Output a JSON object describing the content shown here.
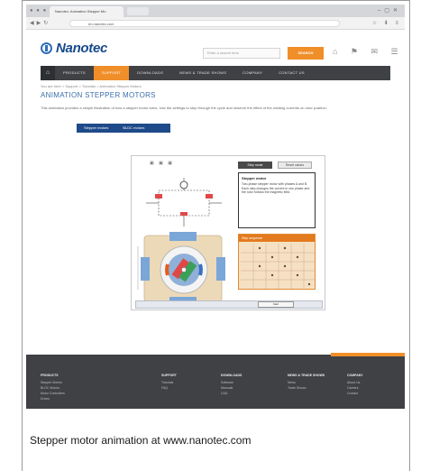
{
  "browser": {
    "tab_title": "Nanotec: Animation Stepper Mo",
    "url": "en.nanotec.com"
  },
  "header": {
    "logo_text": "Nanotec",
    "search_placeholder": "Enter a search term",
    "search_button": "SEARCH"
  },
  "nav": {
    "items": [
      "PRODUCTS",
      "SUPPORT",
      "DOWNLOADS",
      "NEWS & TRADE SHOWS",
      "COMPANY",
      "CONTACT US"
    ],
    "active_index": 1
  },
  "breadcrumb": "You are here > Support > Tutorials > Animation Stepper Motors",
  "page_title": "ANIMATION STEPPER MOTORS",
  "intro_text": "This animation provides a simple illustration of how a stepper motor turns. Use the settings to step through the cycle and observe the effect of the winding currents on rotor position.",
  "subtabs": [
    "Stepper motors",
    "BLDC motors"
  ],
  "applet": {
    "mode_button_1": "Step mode",
    "mode_button_2": "Reset values",
    "info_title": "Stepper motor",
    "info_text": "Two-phase stepper motor with phases A and B. Each step changes the current in one phase and the rotor follows the magnetic field.",
    "table_title": "Step sequence",
    "control_button": "Start"
  },
  "footer": {
    "columns": [
      {
        "title": "PRODUCTS",
        "items": [
          "Stepper Motors",
          "BLDC Motors",
          "Motor Controllers",
          "Drives"
        ]
      },
      {
        "title": "SUPPORT",
        "items": [
          "Tutorials",
          "FAQ"
        ]
      },
      {
        "title": "DOWNLOADS",
        "items": [
          "Software",
          "Manuals",
          "CAD"
        ]
      },
      {
        "title": "NEWS & TRADE SHOWS",
        "items": [
          "News",
          "Trade Shows"
        ]
      },
      {
        "title": "COMPANY",
        "items": [
          "About Us",
          "Careers",
          "Contact"
        ]
      }
    ]
  },
  "caption": "Stepper motor animation at www.nanotec.com",
  "colors": {
    "accent_orange": "#f08f2a",
    "brand_blue": "#174a8c",
    "nav_dark": "#3f4145"
  }
}
